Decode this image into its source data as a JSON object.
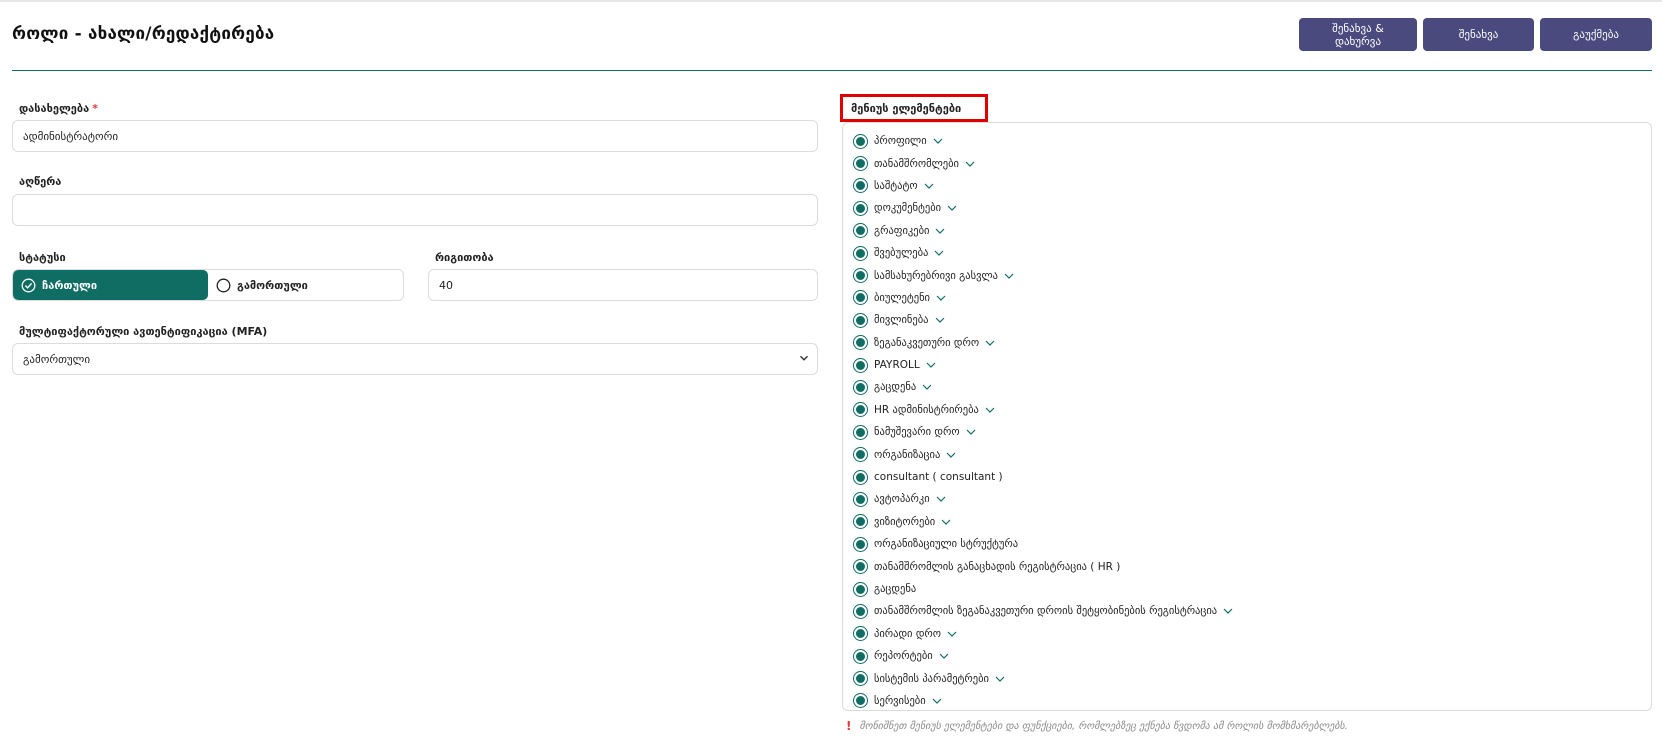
{
  "page": {
    "title": "როლი - ახალი/რედაქტირება"
  },
  "header_buttons": {
    "save_close": "შენახვა & დახურვა",
    "save": "შენახვა",
    "cancel": "გაუქმება"
  },
  "form": {
    "name": {
      "label": "დასახელება",
      "required_mark": "*",
      "value": "ადმინისტრატორი"
    },
    "description": {
      "label": "აღწერა",
      "value": ""
    },
    "status": {
      "label": "სტატუსი",
      "options": [
        "ჩართული",
        "გამორთული"
      ],
      "selected": "ჩართული"
    },
    "order": {
      "label": "რიგითობა",
      "value": "40"
    },
    "mfa": {
      "label": "მულტიფაქტორული ავთენტიფიკაცია (MFA)",
      "selected": "გამორთული"
    }
  },
  "menu": {
    "label": "მენიუს ელემენტები",
    "items": [
      {
        "label": "პროფილი",
        "expandable": true
      },
      {
        "label": "თანამშრომლები",
        "expandable": true
      },
      {
        "label": "საშტატო",
        "expandable": true
      },
      {
        "label": "დოკუმენტები",
        "expandable": true
      },
      {
        "label": "გრაფიკები",
        "expandable": true
      },
      {
        "label": "შვებულება",
        "expandable": true
      },
      {
        "label": "სამსახურებრივი გასვლა",
        "expandable": true
      },
      {
        "label": "ბიულეტენი",
        "expandable": true
      },
      {
        "label": "მივლინება",
        "expandable": true
      },
      {
        "label": "ზეგანაკვეთური დრო",
        "expandable": true
      },
      {
        "label": "PAYROLL",
        "expandable": true
      },
      {
        "label": "გაცდენა",
        "expandable": true
      },
      {
        "label": "HR ადმინისტრირება",
        "expandable": true
      },
      {
        "label": "ნამუშევარი დრო",
        "expandable": true
      },
      {
        "label": "ორგანიზაცია",
        "expandable": true
      },
      {
        "label": "consultant ( consultant )",
        "expandable": false
      },
      {
        "label": "ავტოპარკი",
        "expandable": true
      },
      {
        "label": "ვიზიტორები",
        "expandable": true
      },
      {
        "label": "ორგანიზაციული სტრუქტურა",
        "expandable": false
      },
      {
        "label": "თანამშრომლის განაცხადის რეგისტრაცია ( HR )",
        "expandable": false
      },
      {
        "label": "გაცდენა",
        "expandable": false
      },
      {
        "label": "თანამშრომლის ზეგანაკვეთური დროის შეტყობინების რეგისტრაცია",
        "expandable": true
      },
      {
        "label": "პირადი დრო",
        "expandable": true
      },
      {
        "label": "რეპორტები",
        "expandable": true
      },
      {
        "label": "სისტემის პარამეტრები",
        "expandable": true
      },
      {
        "label": "სერვისები",
        "expandable": true
      }
    ],
    "hint_icon": "!",
    "hint": "მონიშნეთ მენიუს ელემენტები და ფუნქციები, რომლებზეც ექნება წვდომა ამ როლის მომხმარებლებს."
  },
  "colors": {
    "primary_button": "#4b4a7e",
    "accent_teal": "#0f6d63",
    "highlight_border": "#e00000",
    "required": "#e53935"
  }
}
